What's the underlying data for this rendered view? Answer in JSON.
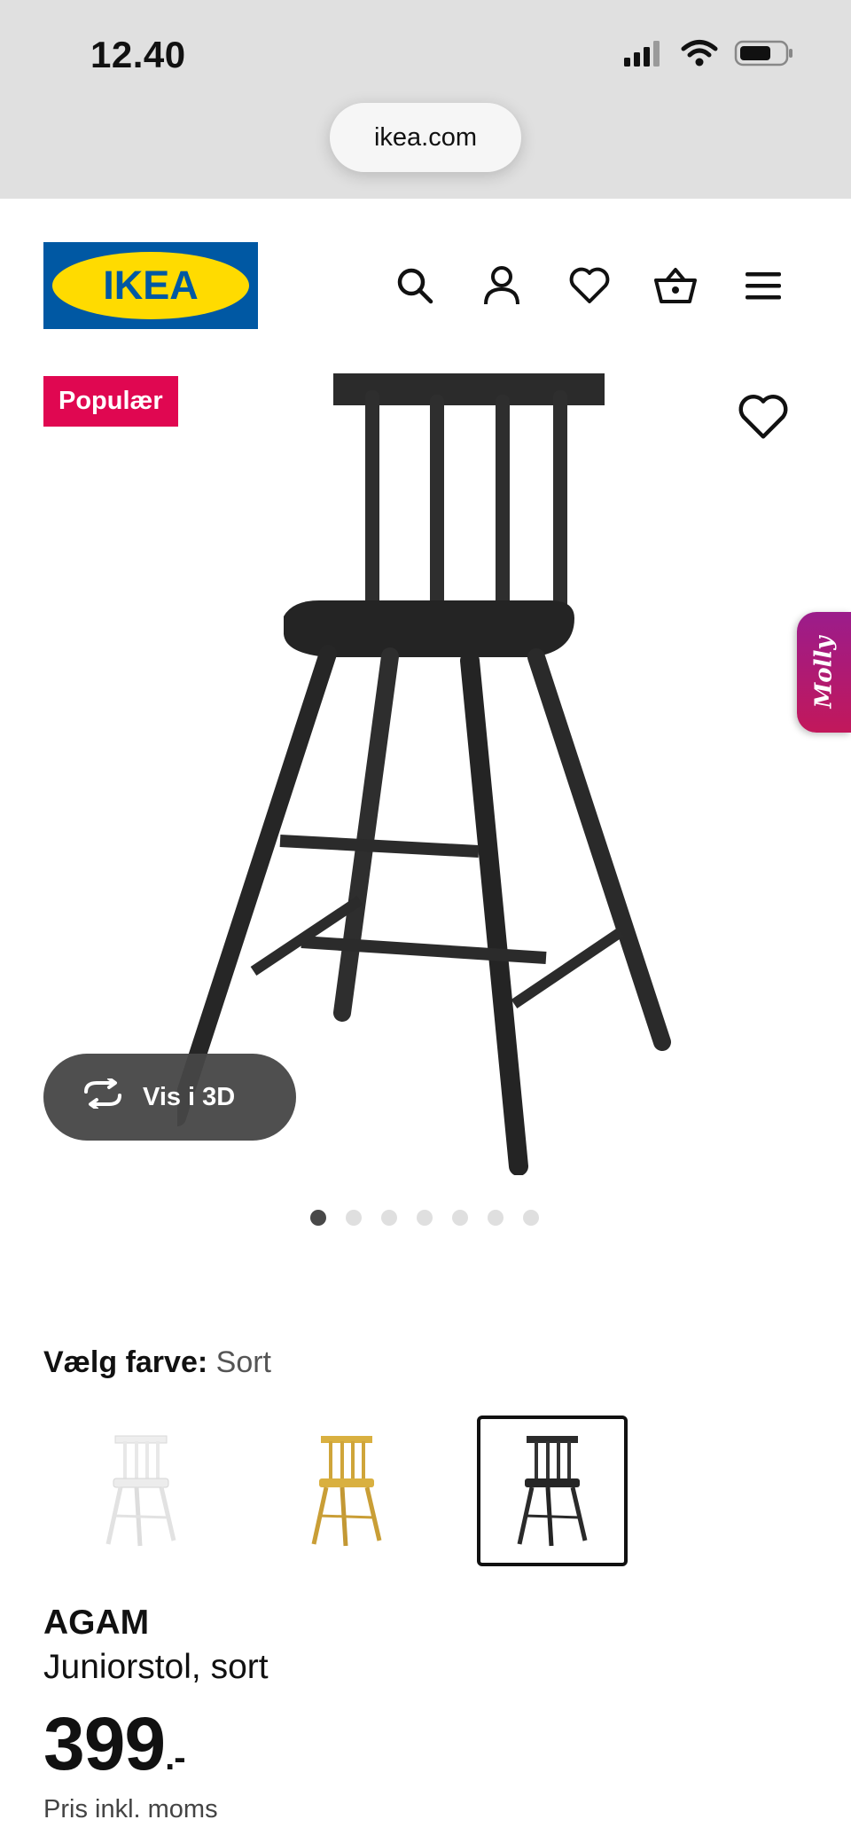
{
  "status_bar": {
    "time": "12.40",
    "signal_icon": "cellular-signal-icon",
    "wifi_icon": "wifi-icon",
    "battery_icon": "battery-icon"
  },
  "browser": {
    "url": "ikea.com"
  },
  "header": {
    "logo_text": "IKEA",
    "brand_colors": {
      "blue": "#0058a3",
      "yellow": "#ffdb00"
    },
    "icons": [
      "search-icon",
      "account-icon",
      "favorites-heart-icon",
      "shopping-basket-icon",
      "menu-hamburger-icon"
    ]
  },
  "product_image": {
    "badge": "Populær",
    "badge_color": "#e00751",
    "favorite_icon": "heart-outline-icon",
    "molly_tab": "Molly",
    "view_3d_label": "Vis i 3D",
    "view_3d_icon": "rotate-3d-icon",
    "carousel": {
      "count": 7,
      "active_index": 0
    }
  },
  "color_picker": {
    "label": "Vælg farve:",
    "selected_value": "Sort",
    "options": [
      {
        "name": "white",
        "color": "#f2f2f2"
      },
      {
        "name": "yellow",
        "color": "#d9b040"
      },
      {
        "name": "black",
        "color": "#2b2b2b"
      }
    ],
    "selected_index": 2
  },
  "product": {
    "name": "AGAM",
    "description": "Juniorstol, sort",
    "price_main": "399",
    "price_suffix": ".-",
    "price_note": "Pris inkl. moms"
  }
}
